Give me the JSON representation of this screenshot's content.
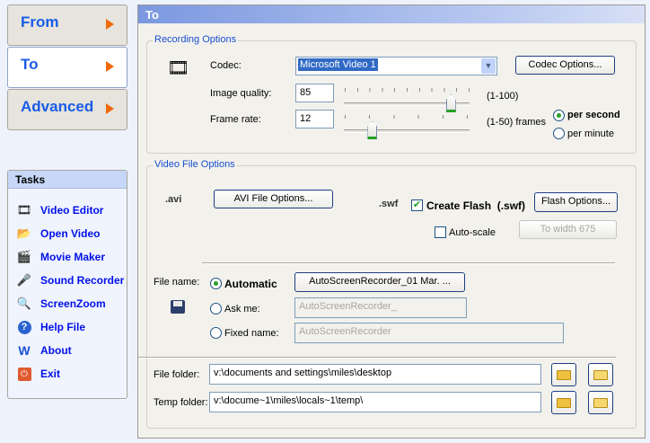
{
  "nav": {
    "from": "From",
    "to": "To",
    "advanced": "Advanced"
  },
  "tasks": {
    "title": "Tasks",
    "items": [
      "Video Editor",
      "Open Video",
      "Movie Maker",
      "Sound Recorder",
      "ScreenZoom",
      "Help File",
      "About",
      "Exit"
    ]
  },
  "panel": {
    "title": "To"
  },
  "recording": {
    "group_label": "Recording Options",
    "codec_label": "Codec:",
    "codec_value": "Microsoft Video 1",
    "codec_options": "Codec Options...",
    "quality_label": "Image quality:",
    "quality_value": "85",
    "quality_range": "(1-100)",
    "frame_label": "Frame rate:",
    "frame_value": "12",
    "frame_range": "(1-50) frames",
    "per_second": "per second",
    "per_minute": "per minute"
  },
  "slider_values": {
    "quality": 85,
    "quality_min": 1,
    "quality_max": 100,
    "frame": 12,
    "frame_min": 1,
    "frame_max": 50
  },
  "video": {
    "group_label": "Video File Options",
    "avi_icon": ".avi",
    "avi_options": "AVI File Options...",
    "swf_icon": ".swf",
    "create_flash": "Create Flash  (.swf)",
    "flash_options": "Flash Options...",
    "auto_scale": "Auto-scale",
    "to_width": "To width 675",
    "file_name_label": "File name:",
    "automatic": "Automatic",
    "automatic_value": "AutoScreenRecorder_01 Mar. ...",
    "ask_me": "Ask me:",
    "ask_me_value": "AutoScreenRecorder_",
    "fixed_name": "Fixed name:",
    "fixed_name_value": "AutoScreenRecorder",
    "file_folder_label": "File folder:",
    "file_folder_value": "v:\\documents and settings\\miles\\desktop",
    "temp_folder_label": "Temp folder:",
    "temp_folder_value": "v:\\docume~1\\miles\\locals~1\\temp\\"
  }
}
